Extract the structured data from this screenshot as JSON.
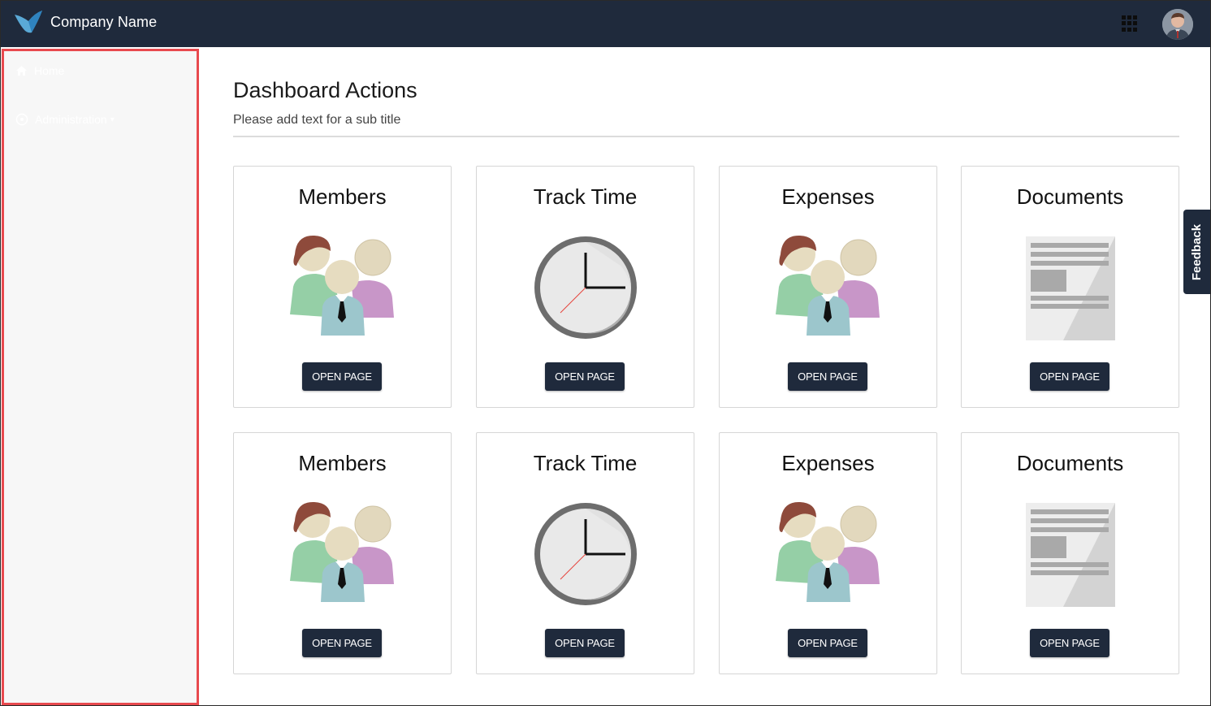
{
  "header": {
    "brand": "Company Name",
    "apps_icon": "grid-icon",
    "avatar_icon": "user-avatar"
  },
  "sidebar": {
    "items": [
      {
        "label": "Home",
        "icon": "home-icon"
      },
      {
        "label": "Administration",
        "icon": "gear-icon",
        "caret": "▾"
      }
    ],
    "highlight_color": "#e84a4f"
  },
  "page": {
    "title": "Dashboard Actions",
    "subtitle": "Please add text for a sub title"
  },
  "cards": [
    {
      "title": "Members",
      "icon": "members-icon",
      "button": "OPEN PAGE"
    },
    {
      "title": "Track Time",
      "icon": "clock-icon",
      "button": "OPEN PAGE"
    },
    {
      "title": "Expenses",
      "icon": "members-icon",
      "button": "OPEN PAGE"
    },
    {
      "title": "Documents",
      "icon": "document-icon",
      "button": "OPEN PAGE"
    },
    {
      "title": "Members",
      "icon": "members-icon",
      "button": "OPEN PAGE"
    },
    {
      "title": "Track Time",
      "icon": "clock-icon",
      "button": "OPEN PAGE"
    },
    {
      "title": "Expenses",
      "icon": "members-icon",
      "button": "OPEN PAGE"
    },
    {
      "title": "Documents",
      "icon": "document-icon",
      "button": "OPEN PAGE"
    }
  ],
  "feedback": {
    "label": "Feedback"
  },
  "colors": {
    "navbar": "#1f2a3c",
    "button": "#1f2a3c",
    "sidebar_bg": "#f7f7f7"
  }
}
